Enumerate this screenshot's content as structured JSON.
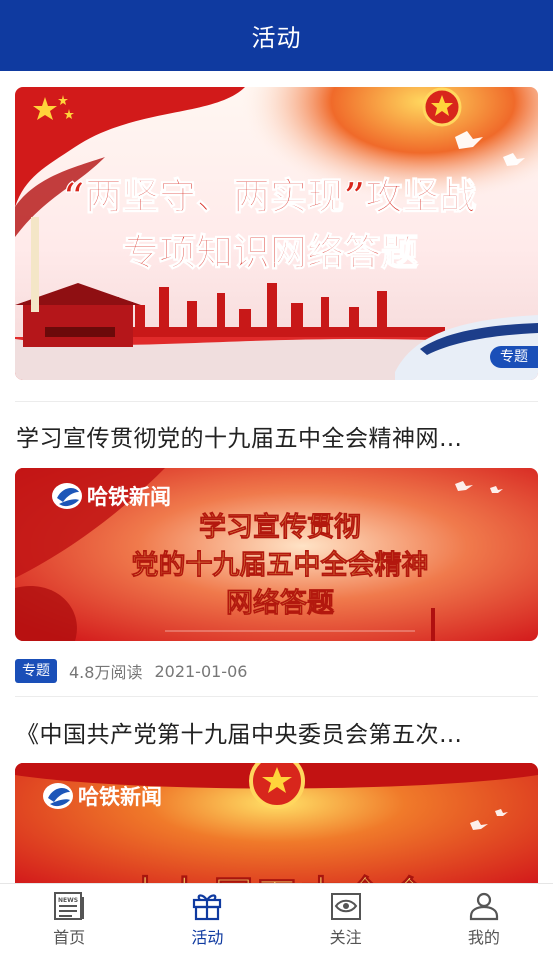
{
  "header": {
    "title": "活动"
  },
  "feed": {
    "item1": {
      "banner_line1": "“两坚守、两实现”攻坚战",
      "banner_line2": "专项知识网络答题",
      "badge": "专题"
    },
    "item2": {
      "title": "学习宣传贯彻党的十九届五中全会精神网…",
      "banner_brand": "哈铁新闻",
      "banner_line1": "学习宣传贯彻",
      "banner_line2": "党的十九届五中全会精神",
      "banner_line3": "网络答题",
      "tag": "专题",
      "reads": "4.8万阅读",
      "date": "2021-01-06"
    },
    "item3": {
      "title": "《中国共产党第十九届中央委员会第五次…",
      "banner_brand": "哈铁新闻",
      "banner_line1": "十九届五中全会"
    }
  },
  "tabbar": {
    "tabs": [
      {
        "label": "首页",
        "icon": "news-icon"
      },
      {
        "label": "活动",
        "icon": "gift-icon"
      },
      {
        "label": "关注",
        "icon": "eye-icon"
      },
      {
        "label": "我的",
        "icon": "person-icon"
      }
    ],
    "active": "活动"
  },
  "colors": {
    "brand_blue": "#0f3aa0",
    "badge_blue": "#1a4fb8",
    "banner_red": "#d42020",
    "banner_yellow": "#f5d27a"
  }
}
